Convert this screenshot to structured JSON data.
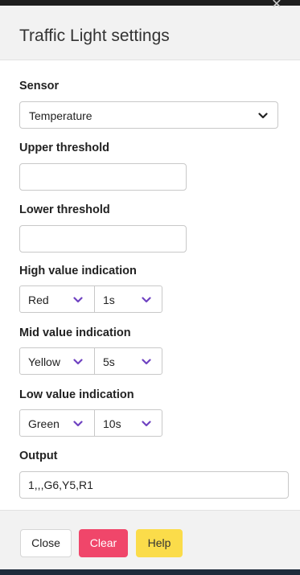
{
  "dialog": {
    "title": "Traffic Light settings",
    "close_icon": "close-icon"
  },
  "form": {
    "sensor": {
      "label": "Sensor",
      "value": "Temperature"
    },
    "upper_threshold": {
      "label": "Upper threshold",
      "value": ""
    },
    "lower_threshold": {
      "label": "Lower threshold",
      "value": ""
    },
    "high_value": {
      "label": "High value indication",
      "color": "Red",
      "duration": "1s"
    },
    "mid_value": {
      "label": "Mid value indication",
      "color": "Yellow",
      "duration": "5s"
    },
    "low_value": {
      "label": "Low value indication",
      "color": "Green",
      "duration": "10s"
    },
    "output": {
      "label": "Output",
      "value": "1,,,G6,Y5,R1"
    }
  },
  "footer": {
    "close_label": "Close",
    "clear_label": "Clear",
    "help_label": "Help"
  },
  "colors": {
    "chevron_accent": "#6f42c1",
    "clear_button": "#f0466a",
    "help_button": "#fbdc4a"
  }
}
